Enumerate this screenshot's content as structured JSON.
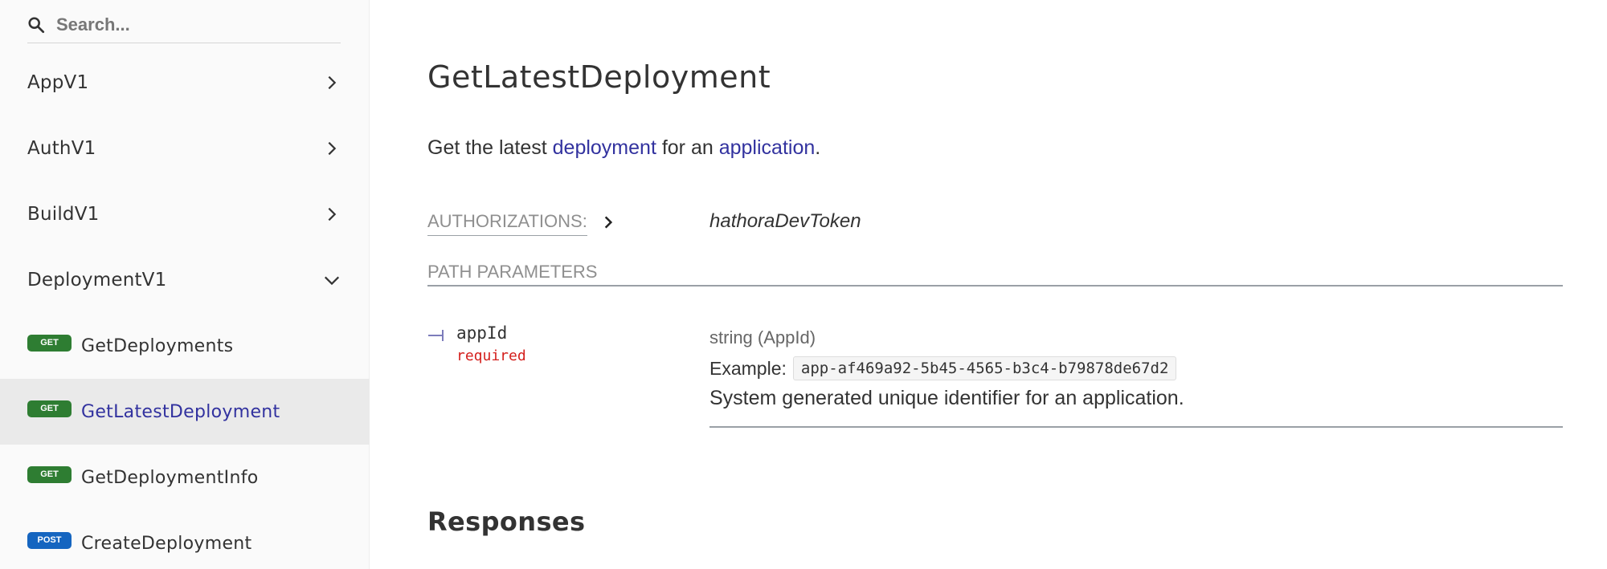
{
  "sidebar": {
    "search": {
      "placeholder": "Search..."
    },
    "groups": [
      {
        "label": "AppV1",
        "expanded": false
      },
      {
        "label": "AuthV1",
        "expanded": false
      },
      {
        "label": "BuildV1",
        "expanded": false
      },
      {
        "label": "DeploymentV1",
        "expanded": true
      }
    ],
    "operations": [
      {
        "method": "GET",
        "label": "GetDeployments",
        "active": false
      },
      {
        "method": "GET",
        "label": "GetLatestDeployment",
        "active": true
      },
      {
        "method": "GET",
        "label": "GetDeploymentInfo",
        "active": false
      },
      {
        "method": "POST",
        "label": "CreateDeployment",
        "active": false
      }
    ]
  },
  "main": {
    "title": "GetLatestDeployment",
    "description": {
      "prefix": "Get the latest ",
      "link1": "deployment",
      "middle": " for an ",
      "link2": "application",
      "suffix": "."
    },
    "authorizations": {
      "label": "AUTHORIZATIONS:",
      "value": "hathoraDevToken"
    },
    "path_parameters": {
      "label": "PATH PARAMETERS",
      "params": [
        {
          "name": "appId",
          "required_label": "required",
          "type": "string (AppId)",
          "example_label": "Example:",
          "example_value": "app-af469a92-5b45-4565-b3c4-b79878de67d2",
          "description": "System generated unique identifier for an application."
        }
      ]
    },
    "responses_title": "Responses"
  },
  "colors": {
    "link": "#32329f",
    "get_badge": "#2e7d32",
    "post_badge": "#1565c0",
    "required": "#d41f1c",
    "sidebar_bg": "#fafafa",
    "active_item_bg": "#eaeaea"
  }
}
